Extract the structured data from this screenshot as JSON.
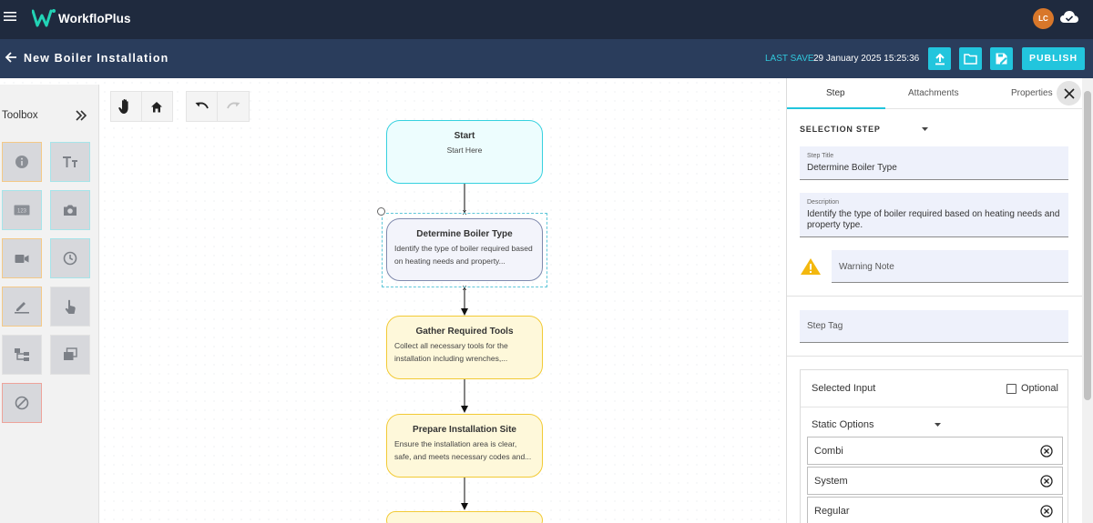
{
  "app": {
    "brand": "WorkfloPlus",
    "avatar_initials": "LC"
  },
  "header": {
    "title": "New Boiler Installation",
    "last_save_label": "LAST SAVE",
    "last_save_value": "29 January 2025 15:25:36",
    "publish_label": "PUBLISH"
  },
  "toolbox": {
    "title": "Toolbox",
    "tools": [
      {
        "icon": "info-icon"
      },
      {
        "icon": "text-icon"
      },
      {
        "icon": "number-icon"
      },
      {
        "icon": "camera-icon"
      },
      {
        "icon": "video-icon"
      },
      {
        "icon": "clock-icon"
      },
      {
        "icon": "signature-icon"
      },
      {
        "icon": "touch-icon"
      },
      {
        "icon": "hierarchy-icon"
      },
      {
        "icon": "gallery-icon"
      },
      {
        "icon": "block-icon"
      }
    ]
  },
  "flow": {
    "start": {
      "title": "Start",
      "desc": "Start Here"
    },
    "connector_remove": "x",
    "nodes": [
      {
        "title": "Determine Boiler Type",
        "desc": "Identify the type of boiler required based on heating needs and property..."
      },
      {
        "title": "Gather Required Tools",
        "desc": "Collect all necessary tools for the installation including wrenches,..."
      },
      {
        "title": "Prepare Installation Site",
        "desc": "Ensure the installation area is clear, safe, and meets necessary codes and..."
      }
    ]
  },
  "panel": {
    "tabs": [
      "Step",
      "Attachments",
      "Properties"
    ],
    "step_type": "SELECTION STEP",
    "step_title_label": "Step Title",
    "step_title_value": "Determine Boiler Type",
    "description_label": "Description",
    "description_value": "Identify the type of boiler required based on heating needs and property type.",
    "warning_placeholder": "Warning Note",
    "step_tag_placeholder": "Step Tag",
    "selected_input_label": "Selected Input",
    "optional_label": "Optional",
    "static_options_label": "Static Options",
    "options": [
      "Combi",
      "System",
      "Regular"
    ]
  },
  "colors": {
    "topbar": "#1f2a3e",
    "subbar": "#2a3d5c",
    "accent": "#22c5dd",
    "start_border": "#36d1df",
    "selected_border": "#7f89ad",
    "step_border": "#f2ca35",
    "warning": "#f3b80f"
  }
}
